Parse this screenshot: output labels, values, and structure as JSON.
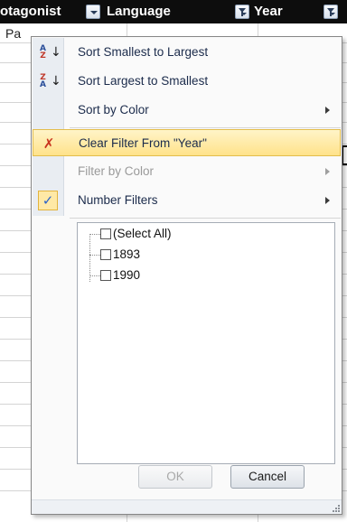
{
  "sheet": {
    "headers": [
      {
        "label": "otagonist",
        "filter_state": "dropdown"
      },
      {
        "label": "Language",
        "filter_state": "filtered"
      },
      {
        "label": "Year",
        "filter_state": "filtered"
      }
    ],
    "row2_text": "Pa"
  },
  "menu": {
    "sort_asc": {
      "label": "Sort Smallest to Largest",
      "icon": "sort-ascending-icon"
    },
    "sort_desc": {
      "label": "Sort Largest to Smallest",
      "icon": "sort-descending-icon"
    },
    "sort_color": {
      "label": "Sort by Color",
      "has_submenu": true
    },
    "clear_filter": {
      "label": "Clear Filter From \"Year\"",
      "icon": "clear-filter-icon",
      "highlighted": true
    },
    "filter_color": {
      "label": "Filter by Color",
      "has_submenu": true,
      "disabled": true
    },
    "number_filters": {
      "label": "Number Filters",
      "has_submenu": true,
      "checked": true
    },
    "values": [
      {
        "label": "(Select All)",
        "checked": false
      },
      {
        "label": "1893",
        "checked": false
      },
      {
        "label": "1990",
        "checked": false
      }
    ],
    "ok_label": "OK",
    "cancel_label": "Cancel"
  },
  "colors": {
    "header_bg": "#0d0d0d",
    "highlight_bg": "#ffe28a",
    "checkmark": "#2b62c8",
    "clear_filter_icon": "#c8321e"
  }
}
